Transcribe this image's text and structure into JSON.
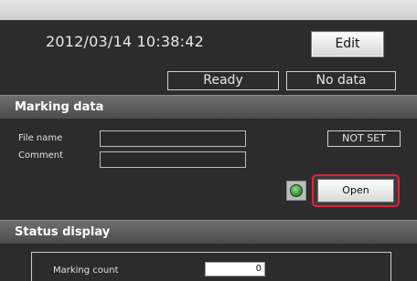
{
  "header": {
    "datetime": "2012/03/14 10:38:42",
    "edit_label": "Edit"
  },
  "status": {
    "state": "Ready",
    "data_state": "No data"
  },
  "marking_data": {
    "section_title": "Marking data",
    "file_name_label": "File name",
    "file_name_value": "",
    "comment_label": "Comment",
    "comment_value": "",
    "not_set_label": "NOT SET",
    "open_label": "Open",
    "lamp_color": "#2f8a2f"
  },
  "status_display": {
    "section_title": "Status display",
    "marking_count_label": "Marking count",
    "marking_count_value": "0"
  },
  "colors": {
    "background": "#2c2c2c",
    "section_bar": "#5c5c5c",
    "highlight_ring": "#e0223a"
  }
}
